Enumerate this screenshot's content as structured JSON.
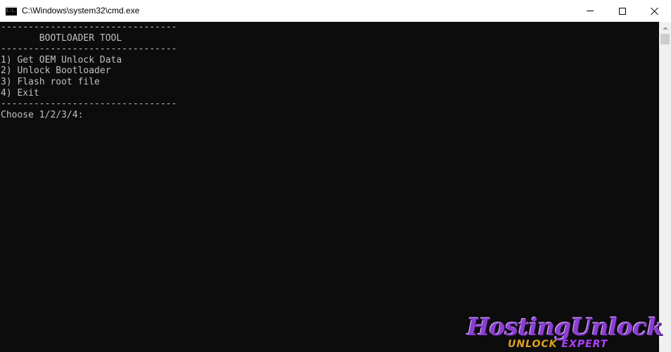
{
  "window": {
    "title": "C:\\Windows\\system32\\cmd.exe",
    "icon_label": "C:\\."
  },
  "console": {
    "lines": [
      "--------------------------------",
      "       BOOTLOADER TOOL",
      "--------------------------------",
      "1) Get OEM Unlock Data",
      "2) Unlock Bootloader",
      "3) Flash root file",
      "4) Exit",
      "--------------------------------",
      "Choose 1/2/3/4:"
    ]
  },
  "watermark": {
    "primary": "HostingUnlock",
    "secondary_a": "UNLOCK",
    "secondary_b": "EXPERT"
  },
  "colors": {
    "console_bg": "#0c0c0c",
    "console_text": "#c0c0c0",
    "titlebar_bg": "#ffffff",
    "watermark_purple": "#8a3fd0",
    "watermark_orange": "#e0a020"
  }
}
